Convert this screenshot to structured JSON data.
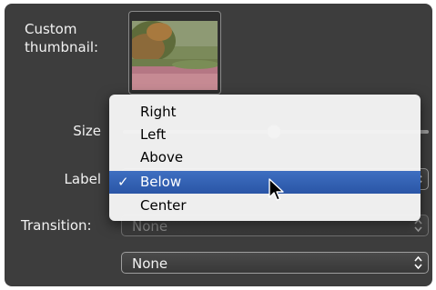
{
  "labels": {
    "custom_thumbnail_line1": "Custom",
    "custom_thumbnail_line2": "thumbnail:",
    "size": "Size",
    "label": "Label",
    "transition": "Transition:"
  },
  "transition_select": {
    "value": "None"
  },
  "second_select": {
    "value": "None"
  },
  "label_menu": {
    "items": [
      "Right",
      "Left",
      "Above",
      "Below",
      "Center"
    ],
    "selected": "Below",
    "check_glyph": "✓"
  },
  "colors": {
    "panel": "#3d3d3d",
    "selection": "#2f5fb4"
  }
}
